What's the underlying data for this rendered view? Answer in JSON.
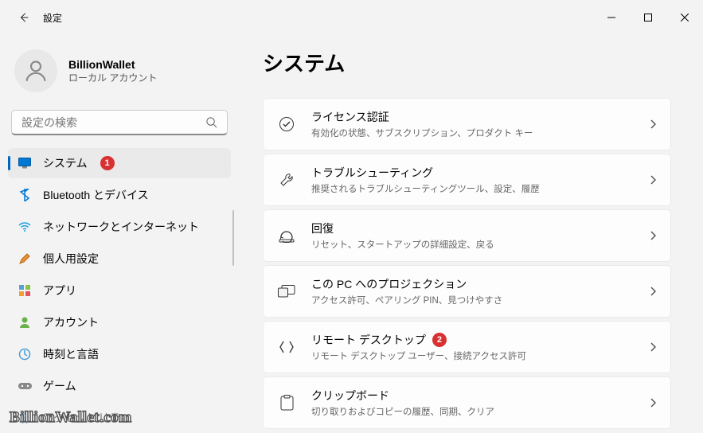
{
  "titlebar": {
    "title": "設定"
  },
  "user": {
    "name": "BillionWallet",
    "type": "ローカル アカウント"
  },
  "search": {
    "placeholder": "設定の検索"
  },
  "nav": [
    {
      "label": "システム",
      "badge": "1"
    },
    {
      "label": "Bluetooth とデバイス"
    },
    {
      "label": "ネットワークとインターネット"
    },
    {
      "label": "個人用設定"
    },
    {
      "label": "アプリ"
    },
    {
      "label": "アカウント"
    },
    {
      "label": "時刻と言語"
    },
    {
      "label": "ゲーム"
    },
    {
      "label": "アクセシビリティ"
    }
  ],
  "page": {
    "title": "システム"
  },
  "cards": [
    {
      "title": "ライセンス認証",
      "desc": "有効化の状態、サブスクリプション、プロダクト キー"
    },
    {
      "title": "トラブルシューティング",
      "desc": "推奨されるトラブルシューティングツール、設定、履歴"
    },
    {
      "title": "回復",
      "desc": "リセット、スタートアップの詳細設定、戻る"
    },
    {
      "title": "この PC へのプロジェクション",
      "desc": "アクセス許可、ペアリング PIN、見つけやすさ"
    },
    {
      "title": "リモート デスクトップ",
      "desc": "リモート デスクトップ ユーザー、接続アクセス許可",
      "badge": "2"
    },
    {
      "title": "クリップボード",
      "desc": "切り取りおよびコピーの履歴、同期、クリア"
    }
  ],
  "watermark": "BillionWallet.com"
}
